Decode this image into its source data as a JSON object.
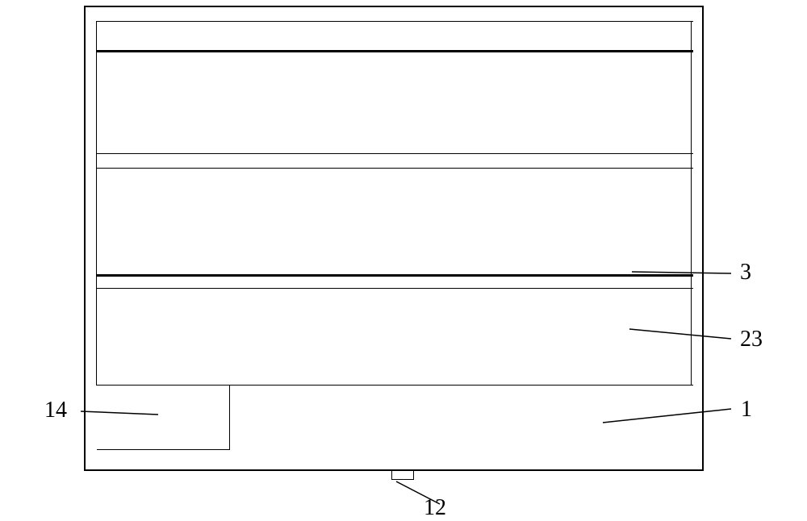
{
  "labels": {
    "ref_3": "3",
    "ref_23": "23",
    "ref_1": "1",
    "ref_14": "14",
    "ref_12": "12"
  }
}
